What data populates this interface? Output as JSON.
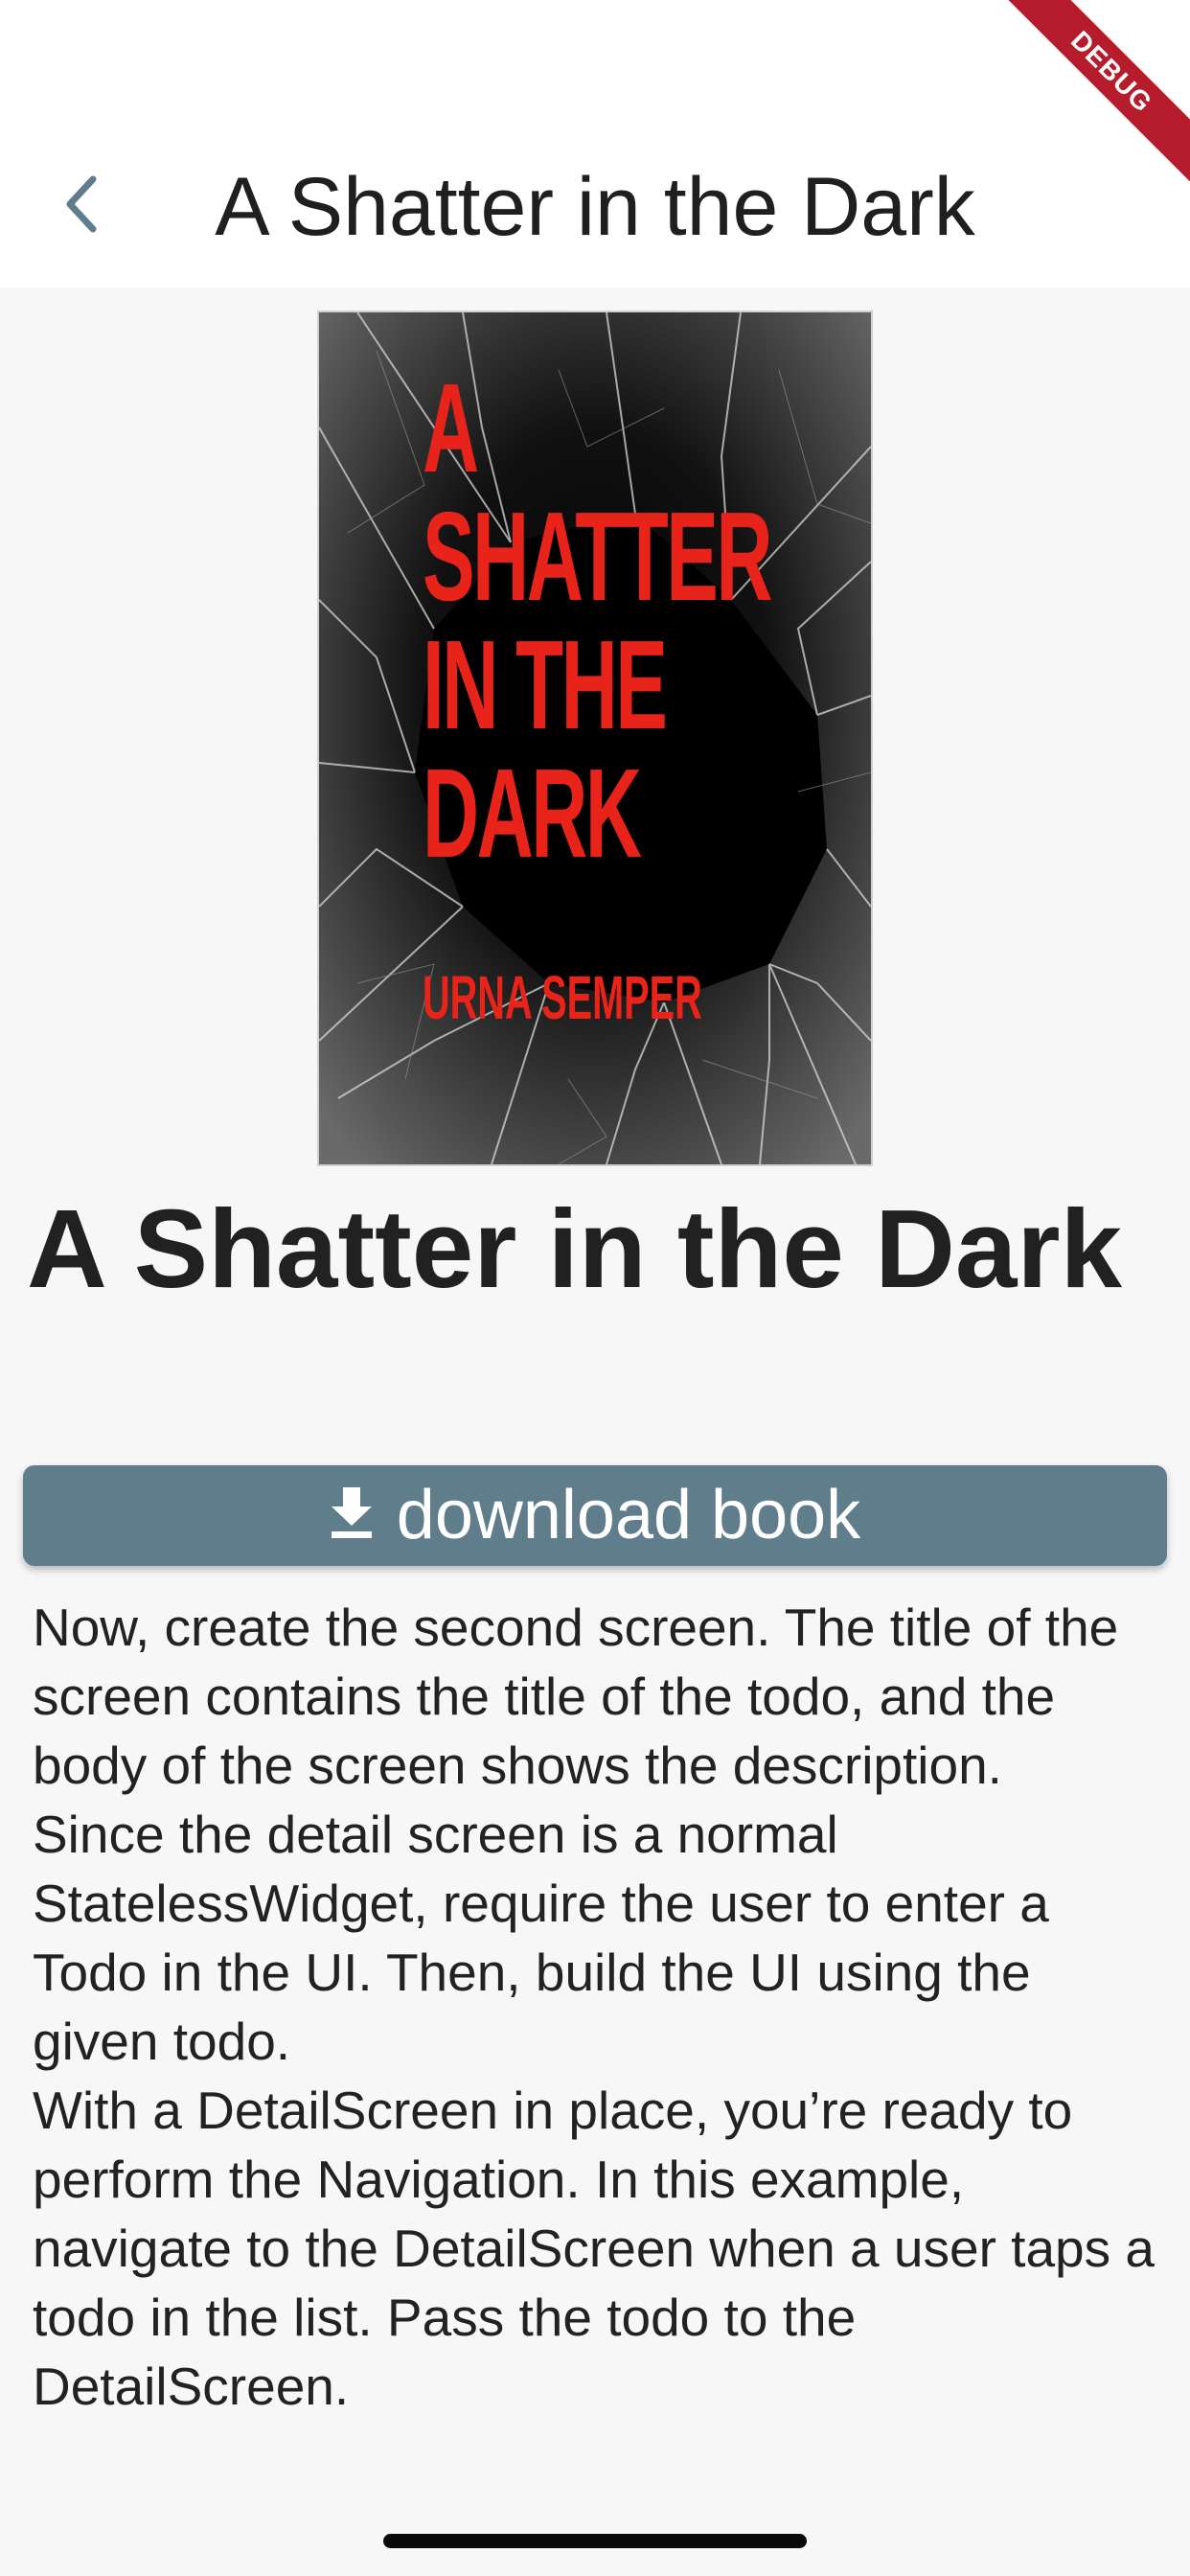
{
  "app_bar": {
    "title": "A Shatter in the Dark",
    "back_icon": "chevron-left-icon",
    "accent_color": "#5f7d8c"
  },
  "debug_banner": {
    "label": "DEBUG",
    "color": "#b71c2c"
  },
  "cover": {
    "title_lines": [
      "A",
      "SHATTER",
      "IN THE",
      "DARK"
    ],
    "author": "URNA SEMPER",
    "title_color": "#e8231a"
  },
  "book": {
    "title": "A Shatter in the Dark"
  },
  "download_button": {
    "label": "download book",
    "icon": "download-icon",
    "color": "#607d8b"
  },
  "description": {
    "paragraphs": [
      "Now, create the second screen. The title of the screen contains the title of the todo, and the body of the screen shows the description.",
      "Since the detail screen is a normal StatelessWidget, require the user to enter a Todo in the UI. Then, build the UI using the given todo.",
      "With a DetailScreen in place, you’re ready to perform the Navigation. In this example, navigate to the DetailScreen when a user taps a todo in the list. Pass the todo to the DetailScreen."
    ]
  }
}
